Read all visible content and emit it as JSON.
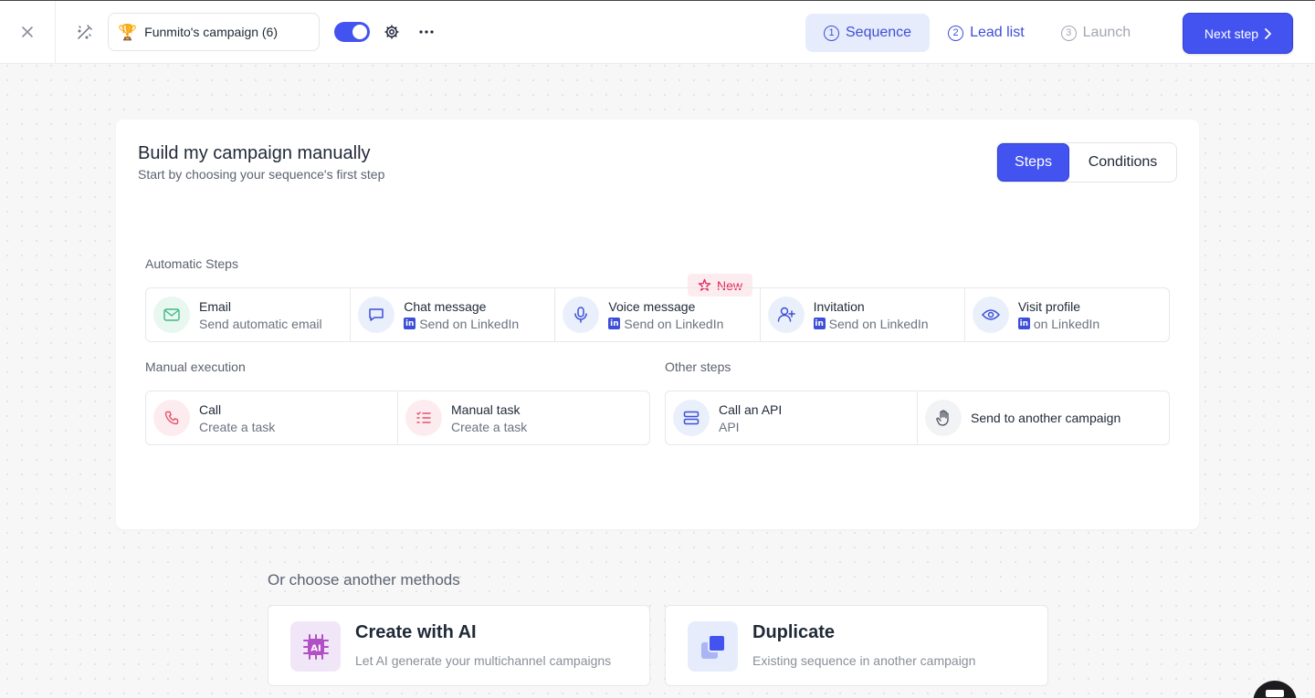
{
  "topbar": {
    "campaign_name": "Funmito's campaign (6)",
    "nav": [
      {
        "num": "1",
        "label": "Sequence"
      },
      {
        "num": "2",
        "label": "Lead list"
      },
      {
        "num": "3",
        "label": "Launch"
      }
    ],
    "next_label": "Next step"
  },
  "card": {
    "title": "Build my campaign manually",
    "subtitle": "Start by choosing your sequence's first step",
    "segment": {
      "steps": "Steps",
      "conditions": "Conditions"
    },
    "badge_new": "New",
    "automatic": {
      "label": "Automatic Steps",
      "items": [
        {
          "title": "Email",
          "sub": "Send automatic email"
        },
        {
          "title": "Chat message",
          "sub": "Send on LinkedIn"
        },
        {
          "title": "Voice message",
          "sub": "Send on LinkedIn"
        },
        {
          "title": "Invitation",
          "sub": "Send on LinkedIn"
        },
        {
          "title": "Visit profile",
          "sub": "on LinkedIn"
        }
      ]
    },
    "manual": {
      "label": "Manual execution",
      "items": [
        {
          "title": "Call",
          "sub": "Create a task"
        },
        {
          "title": "Manual task",
          "sub": "Create a task"
        }
      ]
    },
    "other": {
      "label": "Other steps",
      "items": [
        {
          "title": "Call an API",
          "sub": "API"
        },
        {
          "title": "Send to another campaign"
        }
      ]
    }
  },
  "methods": {
    "title": "Or choose another methods",
    "ai": {
      "icon_text": "AI",
      "title": "Create with AI",
      "sub": "Let AI generate your multichannel campaigns"
    },
    "duplicate": {
      "title": "Duplicate",
      "sub": "Existing sequence in another campaign"
    }
  },
  "colors": {
    "accent": "#4353f0",
    "new_badge": "#e2265a"
  }
}
